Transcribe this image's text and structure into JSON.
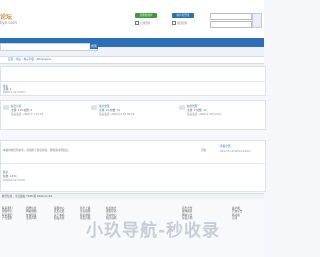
{
  "header": {
    "logo_main": "论坛",
    "logo_sub": "liye.com",
    "register_label": "注册新用户",
    "login_label": "用户名登录",
    "remember_label": "记住密码",
    "forgot_label": "找回密码"
  },
  "search": {
    "button_label": "搜索"
  },
  "breadcrumb": {
    "text": "首页 › 论坛 › 帖子列表 › Workspace"
  },
  "thread_header": {
    "author_label": "版主",
    "author_line": "主题: 1",
    "date_line": "2009-5-12 23:09"
  },
  "forums": [
    {
      "name": "综合讨论",
      "stats": "主题: 115  帖数: 5",
      "last": "最后发表: 2009-7-7 15:33"
    },
    {
      "name": "技术交流",
      "stats": "主题: 15  帖数: 31",
      "last": "最后发表: 2009-12-18 09:29"
    },
    {
      "name": "站务管理",
      "stats": "主题: 2  帖数: 11",
      "last": "最后发表: 2009-2-18 14:52"
    }
  ],
  "notice": {
    "text": "本站内容仅供参考，请勿用于商业用途，转载请注明出处。",
    "reply_prefix": "回复",
    "reply_link": "查看全部",
    "updated": "2017-5-19 09:53 admin"
  },
  "post": {
    "author": "版主",
    "stats": "帖数: 1234",
    "date": "2009-5-12 23:09"
  },
  "footer": {
    "bar_text": "统计信息  ·  今日发帖 7648 篇  2009-11-09",
    "col1": [
      "联系我们",
      "帮助中心",
      "联系我们",
      "广告服务"
    ],
    "col2": [
      "招聘信息",
      "网站地图",
      "友情链接",
      "法律声明"
    ],
    "col3": [
      "客服中心",
      "意见反馈",
      "关于本站",
      "隐私条款"
    ],
    "col4": [
      "新手上路",
      "论坛规则",
      "版主申请",
      "常见问题"
    ],
    "col5": [
      "站长统计",
      "搜索优化",
      "活动中心",
      "积分说明"
    ],
    "col6": [
      "商务合作",
      "媒体报道",
      "网站公告",
      "免责声明"
    ],
    "col7": [
      "客户端",
      "开放平台",
      "移动版",
      "订阅"
    ],
    "watermark": "小玖导航-秒收录"
  }
}
